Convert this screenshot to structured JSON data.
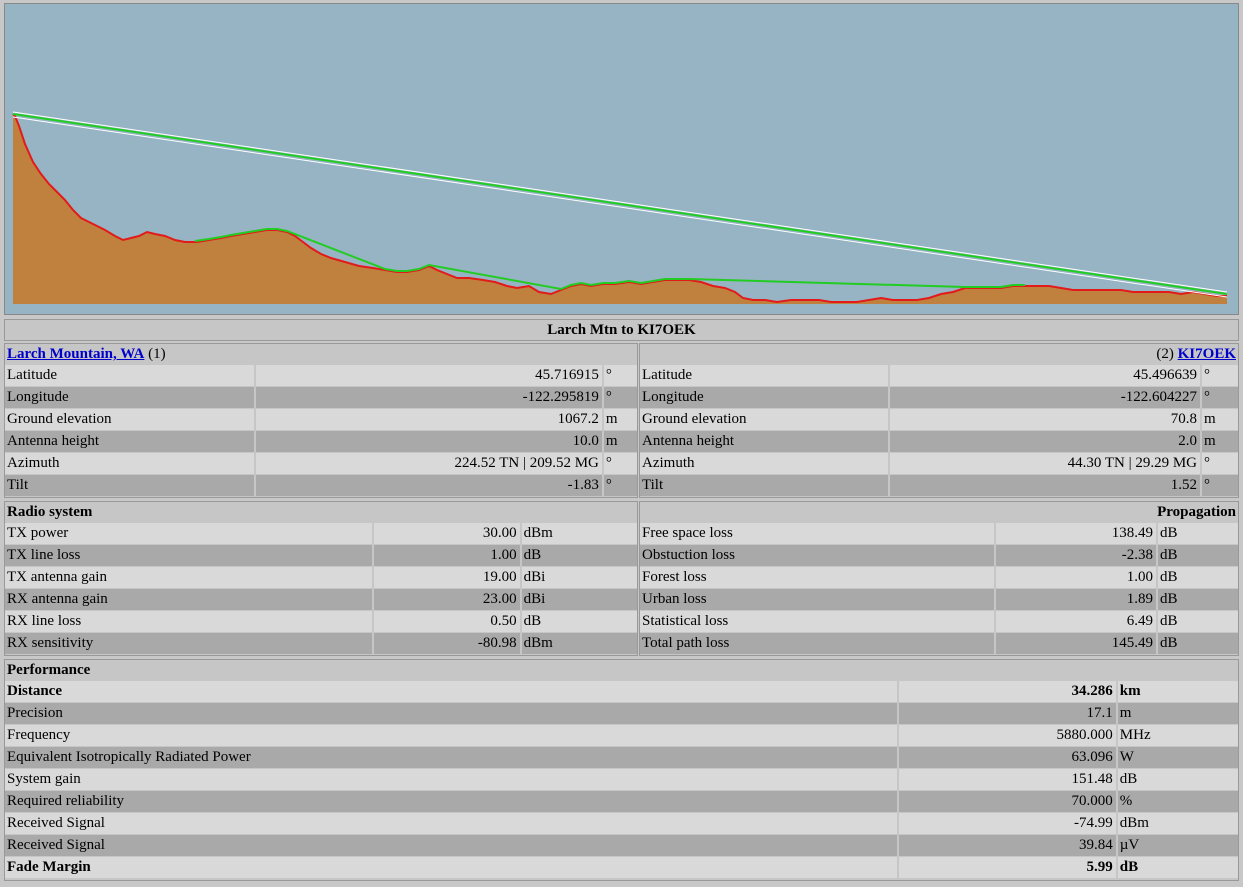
{
  "title": "Larch Mtn to KI7OEK",
  "site1": {
    "name": "Larch Mountain, WA",
    "index": "(1)",
    "rows": [
      {
        "label": "Latitude",
        "value": "45.716915",
        "unit": "°"
      },
      {
        "label": "Longitude",
        "value": "-122.295819",
        "unit": "°"
      },
      {
        "label": "Ground elevation",
        "value": "1067.2",
        "unit": "m"
      },
      {
        "label": "Antenna height",
        "value": "10.0",
        "unit": "m"
      },
      {
        "label": "Azimuth",
        "value": "224.52 TN | 209.52 MG",
        "unit": "°"
      },
      {
        "label": "Tilt",
        "value": "-1.83",
        "unit": "°"
      }
    ]
  },
  "site2": {
    "name": "KI7OEK",
    "index": "(2)",
    "rows": [
      {
        "label": "Latitude",
        "value": "45.496639",
        "unit": "°"
      },
      {
        "label": "Longitude",
        "value": "-122.604227",
        "unit": "°"
      },
      {
        "label": "Ground elevation",
        "value": "70.8",
        "unit": "m"
      },
      {
        "label": "Antenna height",
        "value": "2.0",
        "unit": "m"
      },
      {
        "label": "Azimuth",
        "value": "44.30 TN | 29.29 MG",
        "unit": "°"
      },
      {
        "label": "Tilt",
        "value": "1.52",
        "unit": "°"
      }
    ]
  },
  "radio": {
    "heading": "Radio system",
    "rows": [
      {
        "label": "TX power",
        "value": "30.00",
        "unit": "dBm"
      },
      {
        "label": "TX line loss",
        "value": "1.00",
        "unit": "dB"
      },
      {
        "label": "TX antenna gain",
        "value": "19.00",
        "unit": "dBi"
      },
      {
        "label": "RX antenna gain",
        "value": "23.00",
        "unit": "dBi"
      },
      {
        "label": "RX line loss",
        "value": "0.50",
        "unit": "dB"
      },
      {
        "label": "RX sensitivity",
        "value": "-80.98",
        "unit": "dBm"
      }
    ]
  },
  "propagation": {
    "heading": "Propagation",
    "rows": [
      {
        "label": "Free space loss",
        "value": "138.49",
        "unit": "dB"
      },
      {
        "label": "Obstuction loss",
        "value": "-2.38",
        "unit": "dB"
      },
      {
        "label": "Forest loss",
        "value": "1.00",
        "unit": "dB"
      },
      {
        "label": "Urban loss",
        "value": "1.89",
        "unit": "dB"
      },
      {
        "label": "Statistical loss",
        "value": "6.49",
        "unit": "dB"
      },
      {
        "label": "Total path loss",
        "value": "145.49",
        "unit": "dB"
      }
    ]
  },
  "performance": {
    "heading": "Performance",
    "rows": [
      {
        "label": "Distance",
        "value": "34.286",
        "unit": "km",
        "bold": true
      },
      {
        "label": "Precision",
        "value": "17.1",
        "unit": "m"
      },
      {
        "label": "Frequency",
        "value": "5880.000",
        "unit": "MHz"
      },
      {
        "label": "Equivalent Isotropically Radiated Power",
        "value": "63.096",
        "unit": "W"
      },
      {
        "label": "System gain",
        "value": "151.48",
        "unit": "dB"
      },
      {
        "label": "Required reliability",
        "value": "70.000",
        "unit": "%"
      },
      {
        "label": "Received Signal",
        "value": "-74.99",
        "unit": "dBm"
      },
      {
        "label": "Received Signal",
        "value": "39.84",
        "unit": "µV"
      },
      {
        "label": "Fade Margin",
        "value": "5.99",
        "unit": "dB",
        "bold": true
      }
    ]
  },
  "colors": {
    "sky": "#97b4c5",
    "terrain": "#c0813f",
    "clutter": "#e31a1a",
    "fresnel": "#22cc22",
    "beam": "#ffffff"
  }
}
